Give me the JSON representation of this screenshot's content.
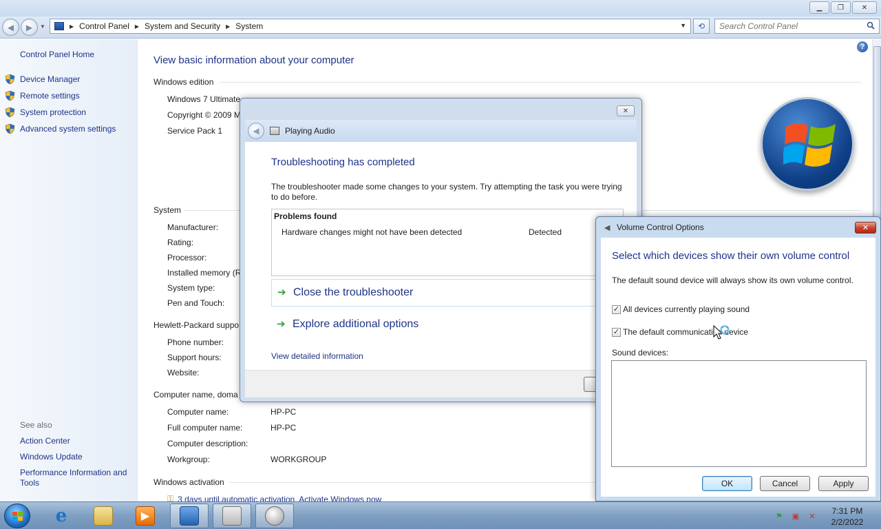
{
  "window": {
    "minimize_icon": "minimize-icon",
    "maximize_icon": "maximize-icon",
    "close_icon": "close-icon"
  },
  "address_bar": {
    "breadcrumbs": [
      "Control Panel",
      "System and Security",
      "System"
    ],
    "search_placeholder": "Search Control Panel"
  },
  "left_pane": {
    "home": "Control Panel Home",
    "tasks": [
      "Device Manager",
      "Remote settings",
      "System protection",
      "Advanced system settings"
    ],
    "see_also_label": "See also",
    "see_also": [
      "Action Center",
      "Windows Update",
      "Performance Information and Tools"
    ]
  },
  "main": {
    "title": "View basic information about your computer",
    "edition": {
      "heading": "Windows edition",
      "name": "Windows 7 Ultimate",
      "copyright": "Copyright © 2009 M",
      "service_pack": "Service Pack 1"
    },
    "system": {
      "heading": "System",
      "labels": [
        "Manufacturer:",
        "Rating:",
        "Processor:",
        "Installed memory (R",
        "System type:",
        "Pen and Touch:"
      ]
    },
    "support": {
      "heading": "Hewlett-Packard suppo",
      "labels": [
        "Phone number:",
        "Support hours:",
        "Website:"
      ]
    },
    "computer": {
      "heading": "Computer name, doma",
      "rows": [
        {
          "label": "Computer name:",
          "value": "HP-PC"
        },
        {
          "label": "Full computer name:",
          "value": "HP-PC"
        },
        {
          "label": "Computer description:",
          "value": ""
        },
        {
          "label": "Workgroup:",
          "value": "WORKGROUP"
        }
      ]
    },
    "activation": {
      "heading": "Windows activation",
      "link": "3 days until automatic activation. Activate Windows now"
    }
  },
  "troubleshooter": {
    "header_title": "Playing Audio",
    "title": "Troubleshooting has completed",
    "description": "The troubleshooter made some changes to your system. Try attempting the task you were trying to do before.",
    "problems_header": "Problems found",
    "problem": "Hardware changes might not have been detected",
    "problem_status": "Detected",
    "options": [
      "Close the troubleshooter",
      "Explore additional options"
    ],
    "detail_link": "View detailed information"
  },
  "volume_dialog": {
    "title": "Volume Control Options",
    "heading": "Select which devices show their own volume control",
    "description": "The default sound device will always show its own volume control.",
    "checkboxes": [
      {
        "label": "All devices currently playing sound",
        "checked": true
      },
      {
        "label": "The default communication device",
        "checked": true
      }
    ],
    "sound_devices_label": "Sound devices:",
    "buttons": {
      "ok": "OK",
      "cancel": "Cancel",
      "apply": "Apply"
    }
  },
  "taskbar": {
    "items": [
      "internet-explorer-icon",
      "windows-explorer-icon",
      "media-player-icon",
      "control-panel-icon",
      "troubleshooter-icon",
      "speaker-icon"
    ],
    "time": "7:31 PM",
    "date": "2/2/2022"
  }
}
